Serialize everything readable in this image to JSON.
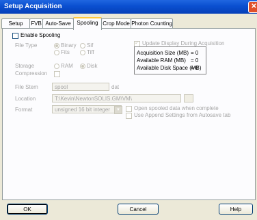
{
  "window": {
    "title": "Setup Acquisition"
  },
  "tabs": [
    {
      "label": "Setup CCD"
    },
    {
      "label": "FVB"
    },
    {
      "label": "Auto-Save"
    },
    {
      "label": "Spooling"
    },
    {
      "label": "Crop Mode"
    },
    {
      "label": "Photon Counting"
    }
  ],
  "spooling": {
    "enable_label": "Enable Spooling",
    "enable_checked": false,
    "file_type_label": "File Type",
    "file_type_options": [
      {
        "label": "Binary",
        "selected": true
      },
      {
        "label": "Sif",
        "selected": false
      },
      {
        "label": "Fits",
        "selected": false
      },
      {
        "label": "Tiff",
        "selected": false
      }
    ],
    "storage_label": "Storage",
    "storage_options": [
      {
        "label": "RAM",
        "selected": false
      },
      {
        "label": "Disk",
        "selected": true
      }
    ],
    "compression_label": "Compression",
    "update_display_label": "Update Display During Acquisition",
    "update_display_checked": true,
    "info": {
      "acq_size_label": "Acquisition Size (MB)",
      "acq_size_value": "= 0",
      "ram_label": "Available RAM (MB)",
      "ram_value": "= 0",
      "disk_label": "Available Disk Space (MB)",
      "disk_value": "= 0"
    },
    "file_stem_label": "File Stem",
    "file_stem_value": "spool",
    "file_ext": "dat",
    "location_label": "Location",
    "location_value": "T:\\Kevin\\NewtonSOLIS.GM\\VM\\",
    "format_label": "Format",
    "format_value": "unsigned 16 bit integer",
    "open_spooled_label": "Open spooled data when complete",
    "append_settings_label": "Use Append Settings from Autosave tab"
  },
  "buttons": {
    "ok": "OK",
    "cancel": "Cancel",
    "help": "Help"
  }
}
